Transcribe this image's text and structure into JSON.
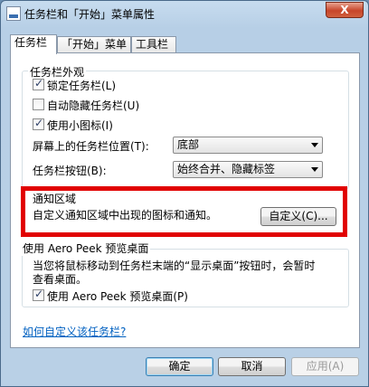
{
  "window": {
    "title": "任务栏和「开始」菜单属性",
    "close_label": "X"
  },
  "tabs": [
    {
      "label": "任务栏"
    },
    {
      "label": "「开始」菜单"
    },
    {
      "label": "工具栏"
    }
  ],
  "appearance": {
    "title": "任务栏外观",
    "lock": {
      "label": "锁定任务栏(L)",
      "checked": true
    },
    "autohide": {
      "label": "自动隐藏任务栏(U)",
      "checked": false
    },
    "small_icons": {
      "label": "使用小图标(I)",
      "checked": true
    },
    "location": {
      "label": "屏幕上的任务栏位置(T):",
      "value": "底部"
    },
    "buttons": {
      "label": "任务栏按钮(B):",
      "value": "始终合并、隐藏标签"
    }
  },
  "notification": {
    "title": "通知区域",
    "description": "自定义通知区域中出现的图标和通知。",
    "customize_button": "自定义(C)..."
  },
  "aero_peek": {
    "title": "使用 Aero Peek 预览桌面",
    "description_line1": "当您将鼠标移动到任务栏末端的“显示桌面”按钮时，会暂时",
    "description_line2": "查看桌面。",
    "checkbox": {
      "label": "使用 Aero Peek 预览桌面(P)",
      "checked": true
    }
  },
  "help_link": "如何自定义该任务栏?",
  "footer": {
    "ok": "确定",
    "cancel": "取消",
    "apply": "应用(A)"
  },
  "colors": {
    "highlight": "#e10000",
    "link": "#0060c0"
  }
}
